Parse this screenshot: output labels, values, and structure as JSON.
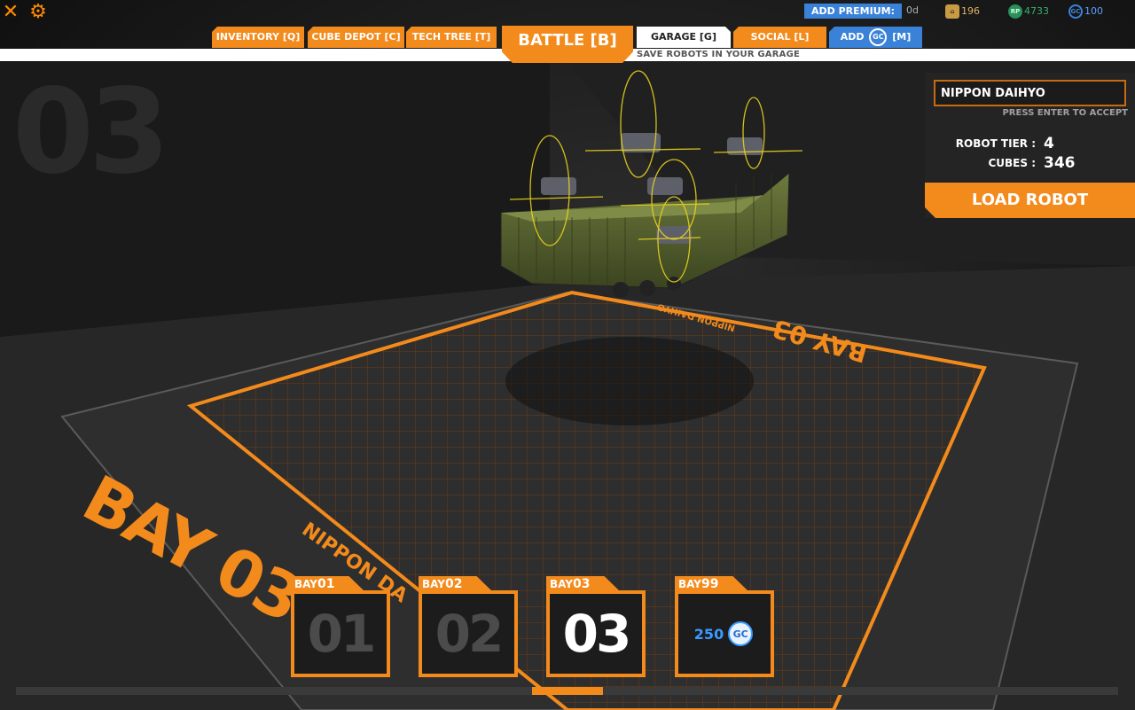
{
  "topbar": {
    "close_icon": "close-icon",
    "settings_icon": "gear-icon",
    "premium_label": "ADD PREMIUM:",
    "premium_days": "0d",
    "currencies": [
      {
        "icon": "robits-icon",
        "value": "196",
        "color": "#e0b060"
      },
      {
        "icon": "rp-icon",
        "value": "4733",
        "color": "#35b072"
      },
      {
        "icon": "gc-icon",
        "value": "100",
        "color": "#3a82d8"
      }
    ]
  },
  "tabs": {
    "inventory": "INVENTORY [Q]",
    "cube_depot": "CUBE DEPOT [C]",
    "tech_tree": "TECH TREE [T]",
    "battle": "BATTLE [B]",
    "garage": "GARAGE [G]",
    "social": "SOCIAL [L]",
    "add_prefix": "ADD",
    "add_suffix": "[M]",
    "gc": "GC",
    "garage_subtitle": "SAVE ROBOTS IN YOUR GARAGE"
  },
  "bay_watermark": "03",
  "panel": {
    "robot_name": "NIPPON DAIHYO",
    "enter_hint": "PRESS ENTER TO ACCEPT",
    "tier_label": "ROBOT TIER :",
    "tier_value": "4",
    "cubes_label": "CUBES :",
    "cubes_value": "346",
    "load_button": "LOAD ROBOT"
  },
  "floor": {
    "big_label": "BAY 03",
    "name_label": "NIPPON DA",
    "far_label": "BAY 03",
    "far_name": "NIPPON DAIHYO"
  },
  "bays": [
    {
      "prefix": "BAY",
      "num": "01",
      "display": "01",
      "active": false
    },
    {
      "prefix": "BAY",
      "num": "02",
      "display": "02",
      "active": false
    },
    {
      "prefix": "BAY",
      "num": "03",
      "display": "03",
      "active": true
    },
    {
      "prefix": "BAY",
      "num": "99",
      "price": "250",
      "gc": "GC",
      "active": false
    }
  ]
}
